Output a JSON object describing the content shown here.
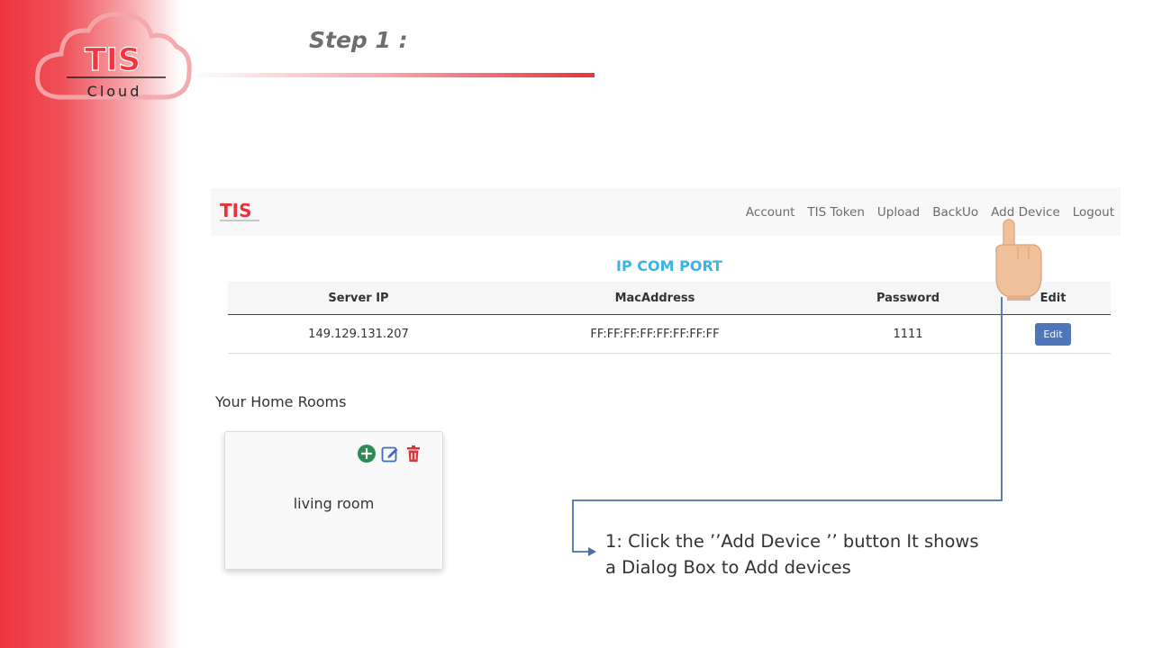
{
  "slide": {
    "step_title": "Step 1 :",
    "logo_text": "TIS",
    "logo_subtext": "Cloud"
  },
  "navbar": {
    "logo_text": "TIS",
    "links": [
      "Account",
      "TIS Token",
      "Upload",
      "BackUo",
      "Add Device",
      "Logout"
    ]
  },
  "ip_section": {
    "title": "IP COM PORT",
    "columns": [
      "Server IP",
      "MacAddress",
      "Password",
      "Edit"
    ],
    "rows": [
      {
        "server_ip": "149.129.131.207",
        "mac_address": "FF:FF:FF:FF:FF:FF:FF:FF",
        "password": "1111",
        "edit_label": "Edit"
      }
    ]
  },
  "rooms": {
    "title": "Your Home Rooms",
    "items": [
      {
        "name": "living room"
      }
    ],
    "icons": [
      "add-icon",
      "edit-icon",
      "trash-icon"
    ]
  },
  "instruction": {
    "line1": "1: Click the ’’Add Device ’’ button It shows",
    "line2": "a Dialog Box to Add devices"
  },
  "colors": {
    "brand_red": "#ee3540",
    "section_title": "#3db3e3",
    "edit_button": "#4e76bb",
    "connector": "#4a6fae",
    "add_icon": "#2e8b57",
    "edit_icon": "#3d6cc0",
    "trash_icon": "#d9343a"
  }
}
